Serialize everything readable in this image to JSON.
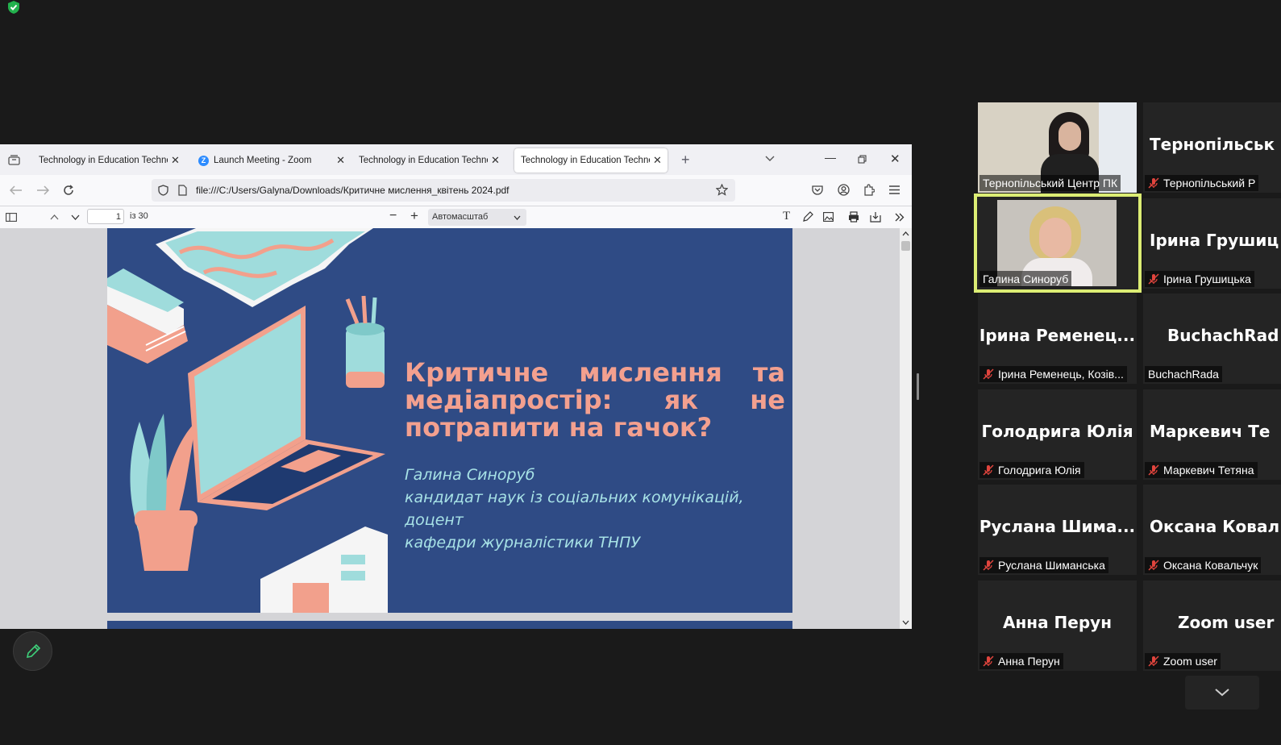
{
  "browser": {
    "tabs": [
      {
        "label": "Technology in Education Technolog",
        "favicon": "none"
      },
      {
        "label": "Launch Meeting - Zoom",
        "favicon": "zoom-logo"
      },
      {
        "label": "Technology in Education Technolog",
        "favicon": "none"
      },
      {
        "label": "Technology in Education Technolog",
        "favicon": "none",
        "active": true
      }
    ],
    "url": "file:///C:/Users/Galyna/Downloads/Критичне мислення_квітень 2024.pdf",
    "icons": [
      "back-icon",
      "forward-icon",
      "reload-icon",
      "shield-icon",
      "page-icon",
      "star-icon",
      "pocket-icon",
      "account-icon",
      "extensions-icon",
      "menu-icon"
    ]
  },
  "pdf_toolbar": {
    "page_number": "1",
    "page_total": "із 30",
    "zoom": "Автомасштаб",
    "icons": [
      "sidebar-toggle-icon",
      "prev-page-icon",
      "next-page-icon",
      "zoom-out-icon",
      "zoom-in-icon",
      "text-icon",
      "draw-icon",
      "image-icon",
      "print-icon",
      "save-icon",
      "more-tools-icon"
    ]
  },
  "slide": {
    "title": "Критичне мислення та медіапростір: як не потрапити на гачок?",
    "author_name": "Галина Синоруб",
    "author_line2": "кандидат наук із соціальних комунікацій, доцент",
    "author_line3": "кафедри журналістики ТНПУ",
    "colors": {
      "background": "#2f4b85",
      "title": "#f3a08f",
      "subtitle": "#a7e2e6"
    }
  },
  "gallery": {
    "tiles": [
      {
        "big": "",
        "label": "Тернопільський Центр ПК",
        "muted": false,
        "video": true
      },
      {
        "big": "Тернопільськ",
        "label": "Тернопільський Р",
        "muted": true
      },
      {
        "big": "",
        "label": "Галина Синоруб",
        "muted": false,
        "video": true,
        "speaking": true
      },
      {
        "big": "Ірина Грушиц",
        "label": "Ірина Грушицька",
        "muted": true
      },
      {
        "big": "Ірина Ременец...",
        "label": "Ірина Ременець, Козів...",
        "muted": true
      },
      {
        "big": "BuchachRad",
        "label": "BuchachRada",
        "muted": false
      },
      {
        "big": "Голодрига Юлія",
        "label": "Голодрига Юлія",
        "muted": true
      },
      {
        "big": "Маркевич Те",
        "label": "Маркевич Тетяна",
        "muted": true
      },
      {
        "big": "Руслана Шима...",
        "label": "Руслана Шиманська",
        "muted": true
      },
      {
        "big": "Оксана Ковал",
        "label": "Оксана Ковальчук",
        "muted": true
      },
      {
        "big": "Анна Перун",
        "label": "Анна Перун",
        "muted": true
      },
      {
        "big": "Zoom user",
        "label": "Zoom user",
        "muted": true
      }
    ]
  }
}
